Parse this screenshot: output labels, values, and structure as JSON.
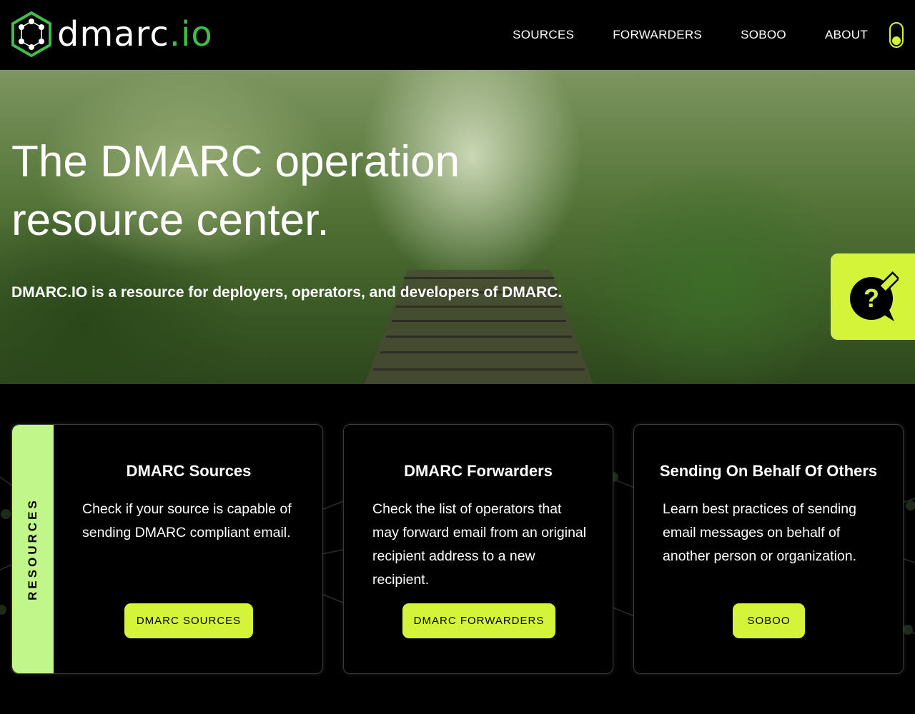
{
  "header": {
    "logo_name": "dmarc",
    "logo_tld": ".io",
    "nav": [
      {
        "label": "SOURCES"
      },
      {
        "label": "FORWARDERS"
      },
      {
        "label": "SOBOO"
      },
      {
        "label": "ABOUT"
      }
    ],
    "theme_toggle_icon": "toggle-switch-icon"
  },
  "hero": {
    "title": "The DMARC operation resource center.",
    "subtitle": "DMARC.IO is a resource for deployers, operators, and developers of DMARC.",
    "help_icon": "question-chat-pencil-icon"
  },
  "resources": {
    "tab_label": "RESOURCES",
    "cards": [
      {
        "title": "DMARC Sources",
        "description": "Check if your source is capable of sending DMARC compliant email.",
        "button": "DMARC SOURCES"
      },
      {
        "title": "DMARC Forwarders",
        "description": "Check the list of operators that may forward email from an original recipient address to a new recipient.",
        "button": "DMARC FORWARDERS"
      },
      {
        "title": "Sending On Behalf Of Others",
        "description": "Learn best practices of sending email messages on behalf of another person or organization.",
        "button": "SOBOO"
      }
    ]
  },
  "colors": {
    "accent": "#d4f43a",
    "tab_green": "#c1f78a",
    "logo_green": "#3fbf4a",
    "background": "#000000"
  }
}
